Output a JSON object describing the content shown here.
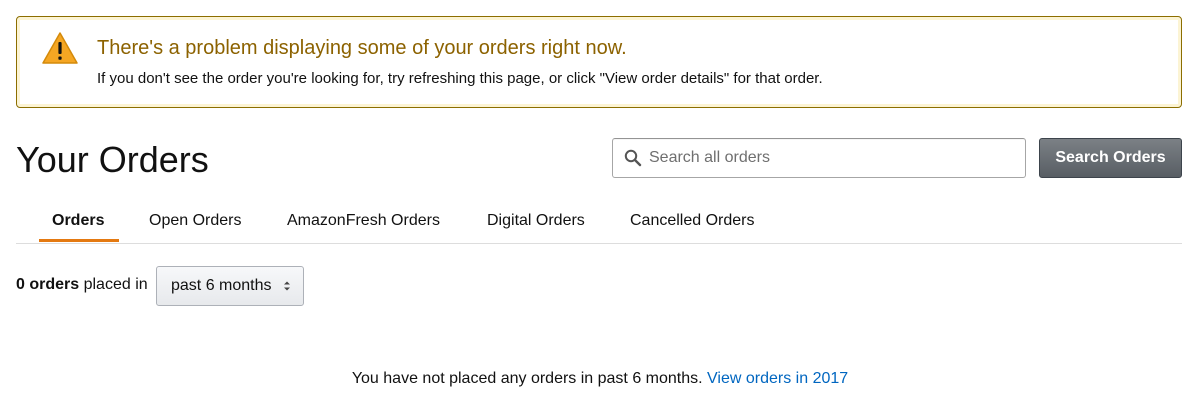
{
  "alert": {
    "icon": "warning-icon",
    "title": "There's a problem displaying some of your orders right now.",
    "body": "If you don't see the order you're looking for, try refreshing this page, or click \"View order details\" for that order.",
    "title_color": "#8c6200",
    "icon_color": "#f5a623"
  },
  "header": {
    "title": "Your Orders"
  },
  "search": {
    "icon": "search-icon",
    "placeholder": "Search all orders",
    "value": "",
    "button_label": "Search Orders"
  },
  "tabs": [
    {
      "label": "Orders",
      "active": true
    },
    {
      "label": "Open Orders",
      "active": false
    },
    {
      "label": "AmazonFresh Orders",
      "active": false
    },
    {
      "label": "Digital Orders",
      "active": false
    },
    {
      "label": "Cancelled Orders",
      "active": false
    }
  ],
  "filter": {
    "count_bold": "0 orders",
    "count_suffix": "placed in",
    "selected_period": "past 6 months"
  },
  "empty_state": {
    "message": "You have not placed any orders in past 6 months.",
    "link_label": "View orders in 2017",
    "link_color": "#0066c0"
  },
  "colors": {
    "tab_underline": "#e47911",
    "alert_border": "#8c6e00"
  }
}
